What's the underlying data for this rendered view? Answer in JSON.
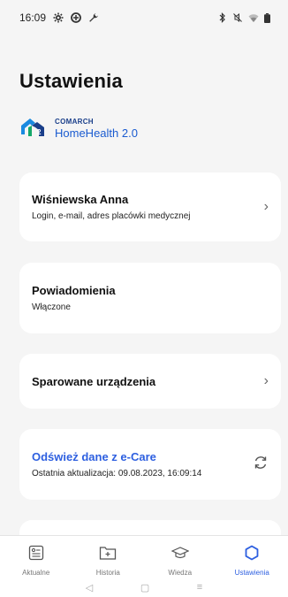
{
  "status_bar": {
    "time": "16:09"
  },
  "page": {
    "title": "Ustawienia"
  },
  "brand": {
    "company": "COMARCH",
    "product": "HomeHealth 2.0"
  },
  "cards": {
    "profile": {
      "title": "Wiśniewska Anna",
      "subtitle": "Login, e-mail, adres placówki medycznej"
    },
    "notifications": {
      "title": "Powiadomienia",
      "subtitle": "Włączone"
    },
    "devices": {
      "title": "Sparowane urządzenia"
    },
    "refresh": {
      "title": "Odśwież dane z e-Care",
      "subtitle": "Ostatnia aktualizacja: 09.08.2023, 16:09:14"
    }
  },
  "bottom_nav": {
    "items": [
      {
        "label": "Aktualne",
        "icon": "dashboard-icon"
      },
      {
        "label": "Historia",
        "icon": "folder-plus-icon"
      },
      {
        "label": "Wiedza",
        "icon": "graduation-cap-icon"
      },
      {
        "label": "Ustawienia",
        "icon": "hexagon-settings-icon",
        "active": true
      }
    ]
  },
  "colors": {
    "accent": "#2d5fe0",
    "background": "#f5f5f5",
    "card": "#ffffff"
  }
}
